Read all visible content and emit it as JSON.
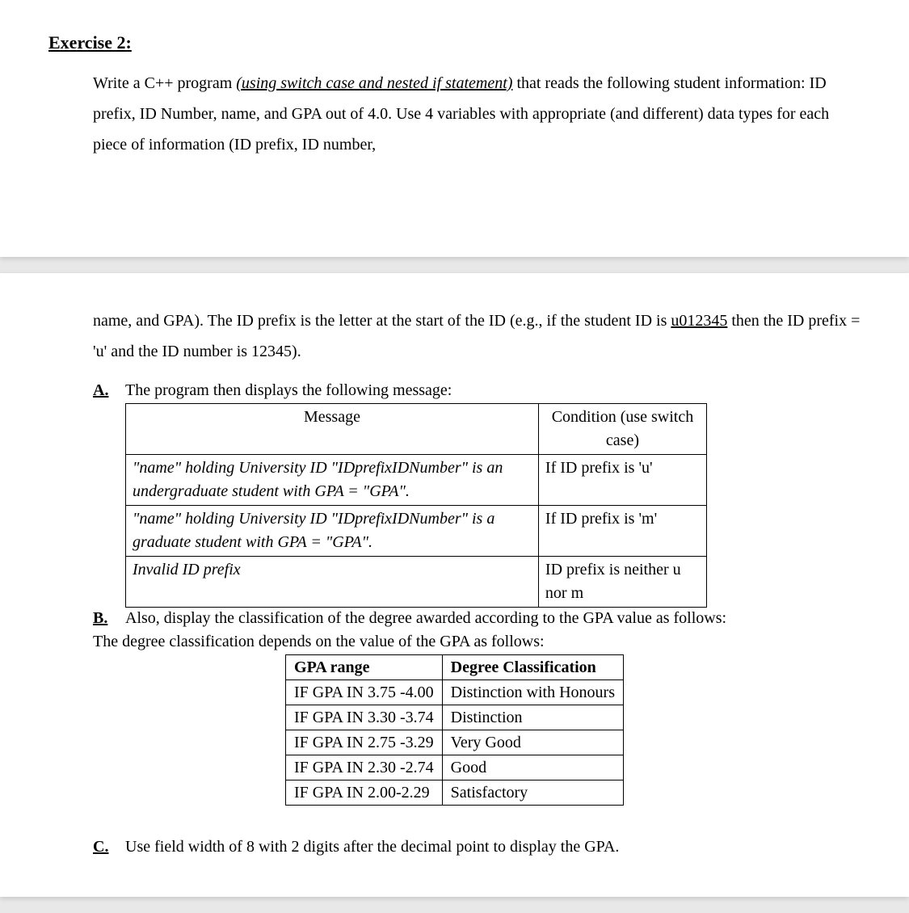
{
  "title": "Exercise 2:",
  "intro": {
    "pre": "Write a C++ program ",
    "emph": "(using switch case and nested if statement)",
    "post1": " that reads the following student information: ID prefix, ID Number, name, and GPA out of 4.0. Use 4 variables with appropriate (and different) data types for each piece of information (ID prefix, ID number,"
  },
  "cont": {
    "pre": "name, and GPA). The ID prefix is the letter at the start of the ID (e.g., if the student ID is ",
    "u": "u012345",
    "post": " then the ID prefix = 'u' and the ID number is 12345)."
  },
  "partA": {
    "label": "A.",
    "text": "The program then displays the following message:",
    "table": {
      "headers": [
        "Message",
        "Condition (use switch case)"
      ],
      "rows": [
        {
          "msg": "\"name\" holding University ID \"IDprefixIDNumber\" is an undergraduate student with GPA = \"GPA\".",
          "cond": "If ID prefix is 'u'"
        },
        {
          "msg": "\"name\" holding University ID \"IDprefixIDNumber\" is a graduate student with GPA = \"GPA\".",
          "cond": "If ID prefix is 'm'"
        },
        {
          "msg": "Invalid ID prefix",
          "cond": "ID prefix is neither u nor m"
        }
      ]
    }
  },
  "partB": {
    "label": "B.",
    "text": "Also, display the classification of the degree awarded according to the GPA value as follows:",
    "sub": "The degree classification depends on the value of the GPA as follows:",
    "table": {
      "headers": [
        "GPA range",
        "Degree Classification"
      ],
      "rows": [
        {
          "r": "IF GPA IN 3.75 -4.00",
          "c": "Distinction with Honours"
        },
        {
          "r": "IF GPA IN 3.30 -3.74",
          "c": "Distinction"
        },
        {
          "r": "IF GPA IN 2.75 -3.29",
          "c": "Very Good"
        },
        {
          "r": "IF GPA IN 2.30 -2.74",
          "c": "Good"
        },
        {
          "r": "IF GPA IN 2.00-2.29",
          "c": "Satisfactory"
        }
      ]
    }
  },
  "partC": {
    "label": "C.",
    "text": "Use field width of 8 with 2 digits after the decimal point to display the GPA."
  }
}
